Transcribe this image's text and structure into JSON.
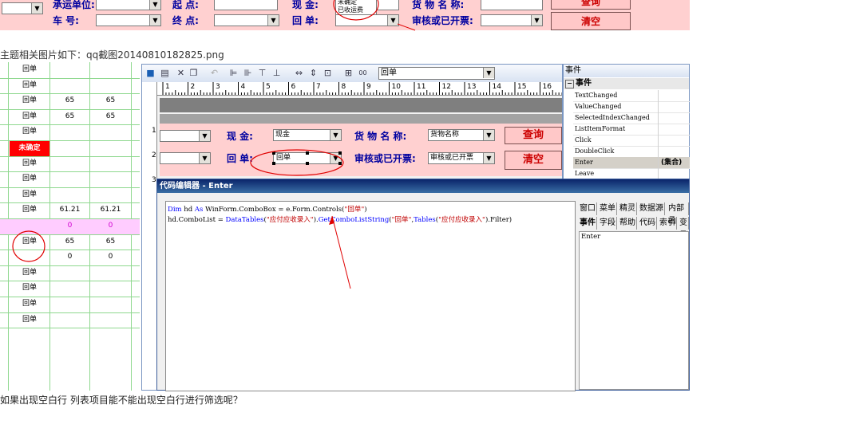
{
  "top_form": {
    "row1": {
      "label_unit": "承运单位:",
      "label_end": "起    点:",
      "label_cash": "现    金:",
      "label_goods": "货 物 名 称:",
      "query_button": "查询",
      "popup_options": [
        "未确定",
        "已收运费"
      ]
    },
    "row2": {
      "label_plate": "车    号:",
      "label_dest": "终    点:",
      "label_receipt": "回    单:",
      "label_audit": "审核或已开票:",
      "clear_button": "清空"
    }
  },
  "caption": "主题相关图片如下：qq截图20140810182825.png",
  "grid": {
    "rows": [
      {
        "c1": "回单",
        "c2": "",
        "c3": "",
        "style": "normal"
      },
      {
        "c1": "回单",
        "c2": "",
        "c3": "",
        "style": "normal"
      },
      {
        "c1": "回单",
        "c2": "65",
        "c3": "65",
        "style": "normal"
      },
      {
        "c1": "回单",
        "c2": "65",
        "c3": "65",
        "style": "normal"
      },
      {
        "c1": "回单",
        "c2": "",
        "c3": "",
        "style": "normal"
      },
      {
        "c1": "未确定",
        "c2": "",
        "c3": "",
        "style": "red"
      },
      {
        "c1": "回单",
        "c2": "",
        "c3": "",
        "style": "normal"
      },
      {
        "c1": "回单",
        "c2": "",
        "c3": "",
        "style": "normal"
      },
      {
        "c1": "回单",
        "c2": "",
        "c3": "",
        "style": "normal"
      },
      {
        "c1": "回单",
        "c2": "61.21",
        "c3": "61.21",
        "style": "normal"
      },
      {
        "c1": "",
        "c2": "0",
        "c3": "0",
        "style": "pink"
      },
      {
        "c1": "回单",
        "c2": "65",
        "c3": "65",
        "style": "normal"
      },
      {
        "c1": "",
        "c2": "0",
        "c3": "0",
        "style": "normal"
      },
      {
        "c1": "回单",
        "c2": "",
        "c3": "",
        "style": "normal"
      },
      {
        "c1": "回单",
        "c2": "",
        "c3": "",
        "style": "normal"
      },
      {
        "c1": "回单",
        "c2": "",
        "c3": "",
        "style": "normal"
      },
      {
        "c1": "回单",
        "c2": "",
        "c3": "",
        "style": "normal"
      }
    ]
  },
  "designer": {
    "toolbar_combo_value": "回单",
    "ruler_numbers": [
      "1",
      "2",
      "3",
      "4",
      "5",
      "6",
      "7",
      "8",
      "9",
      "10",
      "11",
      "12",
      "13",
      "14",
      "15",
      "16"
    ],
    "ruler_v_numbers": [
      "1",
      "2",
      "3"
    ],
    "form": {
      "label_cash": "现    金:",
      "cash_value": "现金",
      "label_goods": "货 物 名 称:",
      "goods_value": "货物名称",
      "query_button": "查询",
      "label_receipt": "回    单:",
      "receipt_value": "回单",
      "label_audit": "审核或已开票:",
      "audit_value": "审核或已开票",
      "clear_button": "清空"
    }
  },
  "events_panel": {
    "title": "事件",
    "section": "事件",
    "events": [
      {
        "name": "TextChanged",
        "value": ""
      },
      {
        "name": "ValueChanged",
        "value": ""
      },
      {
        "name": "SelectedIndexChanged",
        "value": ""
      },
      {
        "name": "ListItemFormat",
        "value": ""
      },
      {
        "name": "Click",
        "value": ""
      },
      {
        "name": "DoubleClick",
        "value": ""
      },
      {
        "name": "Enter",
        "value": "(集合)"
      },
      {
        "name": "Leave",
        "value": ""
      }
    ]
  },
  "code_editor": {
    "title": "代码编辑器 - Enter",
    "line1": {
      "kw1": "Dim",
      "t1": " hd ",
      "kw2": "As",
      "t2": " WinForm.ComboBox = e.Form.Controls(",
      "s1": "\"回单\"",
      "t3": ")"
    },
    "line2": {
      "t1": "hd.ComboList = ",
      "kw1": "DataTables",
      "t2": "(",
      "s1": "\"应付应收录入\"",
      "t3": ").",
      "kw2": "GetComboListString",
      "t4": "(",
      "s2": "\"回单\"",
      "t5": ",",
      "kw3": "Tables",
      "t6": "(",
      "s3": "\"应付应收录入\"",
      "t7": ").Filter)"
    },
    "tabs_row1": [
      "窗口",
      "菜单",
      "精灵",
      "数据源",
      "内部函"
    ],
    "tabs_row2": [
      "事件",
      "字段",
      "帮助",
      "代码",
      "索引",
      "变量"
    ],
    "side_list": [
      "Enter"
    ]
  },
  "question": "如果出现空白行  列表项目能不能出现空白行进行筛选呢？",
  "colors": {
    "banner_bg": "#ffd0d0",
    "label_blue": "#0000a0",
    "label_red": "#cc0000",
    "grid_line": "#8fd88f",
    "annotation_red": "#e00000"
  }
}
